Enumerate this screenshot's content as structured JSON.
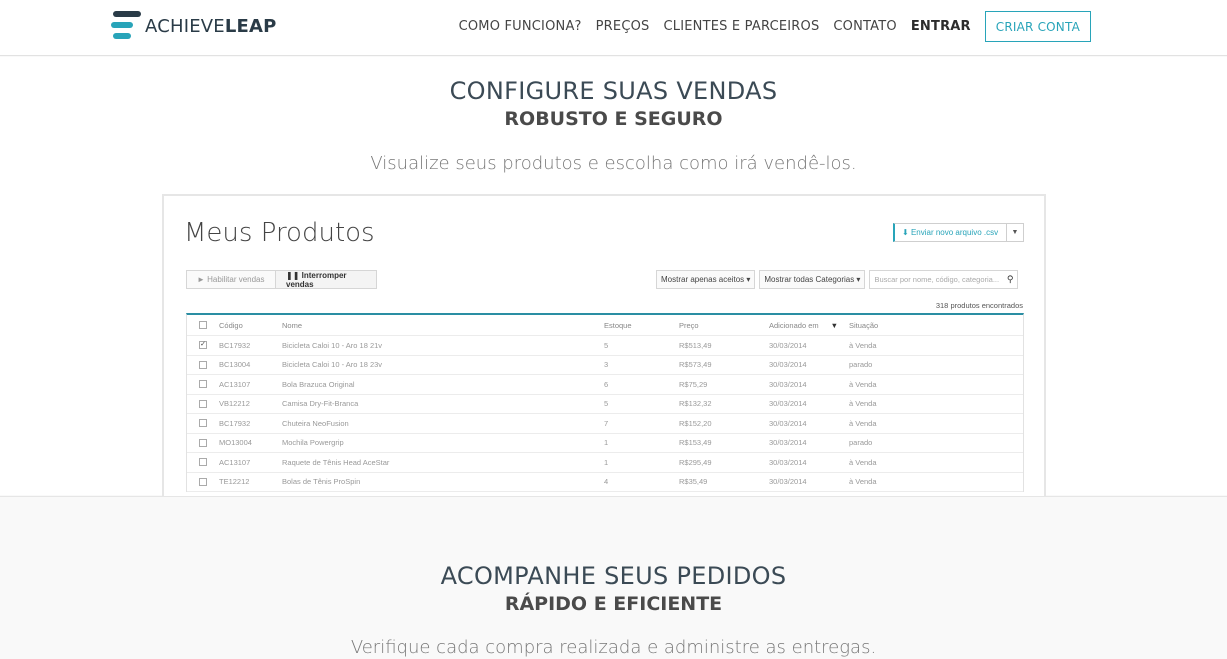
{
  "header": {
    "logo": {
      "light": "ACHIEVE",
      "bold": "LEAP"
    },
    "nav": [
      "COMO FUNCIONA?",
      "PREÇOS",
      "CLIENTES E PARCEIROS",
      "CONTATO"
    ],
    "login": "ENTRAR",
    "signup": "CRIAR CONTA"
  },
  "section1": {
    "title": "CONFIGURE SUAS VENDAS",
    "subtitle": "ROBUSTO E SEGURO",
    "description": "Visualize seus produtos e escolha como irá vendê-los."
  },
  "mock": {
    "title": "Meus Produtos",
    "upload_label": "Enviar novo arquivo .csv",
    "enable_button": "► Habilitar vendas",
    "pause_button": "❚❚ Interromper vendas",
    "filter_accepted": "Mostrar apenas aceitos ▾",
    "filter_categories": "Mostrar todas Categorias ▾",
    "search_placeholder": "Buscar por nome, código, categoria...",
    "count": "318 produtos encontrados",
    "columns": [
      "Código",
      "Nome",
      "Estoque",
      "Preço",
      "Adicionado em",
      "Situação"
    ],
    "rows": [
      {
        "checked": true,
        "code": "BC17932",
        "name": "Bicicleta Caloi 10 - Aro 18 21v",
        "stock": "5",
        "price": "R$513,49",
        "date": "30/03/2014",
        "status": "à Venda"
      },
      {
        "checked": false,
        "code": "BC13004",
        "name": "Bicicleta Caloi 10 - Aro 18 23v",
        "stock": "3",
        "price": "R$573,49",
        "date": "30/03/2014",
        "status": "parado"
      },
      {
        "checked": false,
        "code": "AC13107",
        "name": "Bola Brazuca Original",
        "stock": "6",
        "price": "R$75,29",
        "date": "30/03/2014",
        "status": "à Venda"
      },
      {
        "checked": false,
        "code": "VB12212",
        "name": "Camisa Dry-Fit-Branca",
        "stock": "5",
        "price": "R$132,32",
        "date": "30/03/2014",
        "status": "à Venda"
      },
      {
        "checked": false,
        "code": "BC17932",
        "name": "Chuteira NeoFusion",
        "stock": "7",
        "price": "R$152,20",
        "date": "30/03/2014",
        "status": "à Venda"
      },
      {
        "checked": false,
        "code": "MO13004",
        "name": "Mochila Powergrip",
        "stock": "1",
        "price": "R$153,49",
        "date": "30/03/2014",
        "status": "parado"
      },
      {
        "checked": false,
        "code": "AC13107",
        "name": "Raquete de Tênis Head AceStar",
        "stock": "1",
        "price": "R$295,49",
        "date": "30/03/2014",
        "status": "à Venda"
      },
      {
        "checked": false,
        "code": "TE12212",
        "name": "Bolas de Tênis ProSpin",
        "stock": "4",
        "price": "R$35,49",
        "date": "30/03/2014",
        "status": "à Venda"
      }
    ]
  },
  "section2": {
    "title": "ACOMPANHE SEUS PEDIDOS",
    "subtitle": "RÁPIDO E EFICIENTE",
    "description": "Verifique cada compra realizada e administre as entregas."
  }
}
